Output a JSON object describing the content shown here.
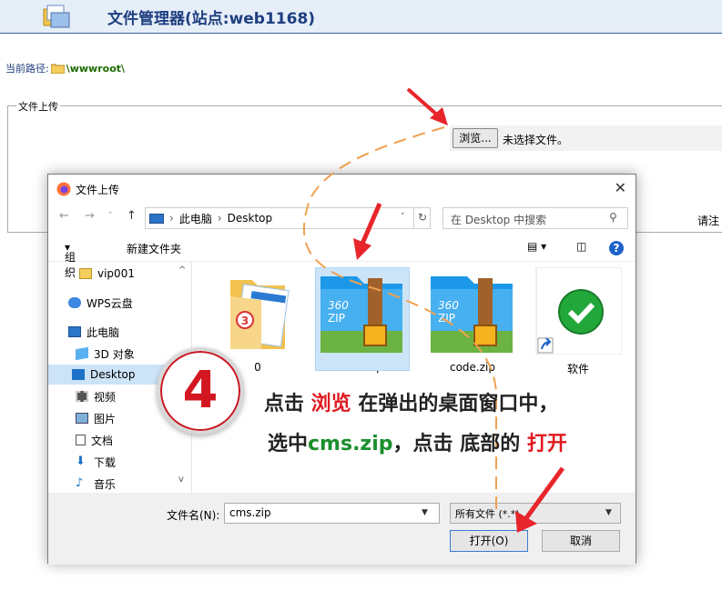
{
  "page": {
    "title": "文件管理器(站点:web1168)",
    "path_label": "当前路径:",
    "path_value": "\\wwwroot\\",
    "upload_legend": "文件上传",
    "browse_label": "浏览...",
    "no_file": "未选择文件。",
    "fill_hint": "请注"
  },
  "dialog": {
    "title": "文件上传",
    "close": "✕",
    "address": [
      "此电脑",
      "Desktop"
    ],
    "search_placeholder": "在 Desktop 中搜索",
    "toolbar": {
      "organize": "组织",
      "new_folder": "新建文件夹"
    },
    "sidebar": [
      {
        "label": "vip001",
        "icon": "folder-icon"
      },
      {
        "label": "WPS云盘",
        "icon": "cloud-icon"
      },
      {
        "label": "此电脑",
        "icon": "computer-icon"
      },
      {
        "label": "3D 对象",
        "icon": "3d-objects-icon"
      },
      {
        "label": "Desktop",
        "icon": "desktop-icon",
        "selected": true
      },
      {
        "label": "视频",
        "icon": "video-icon"
      },
      {
        "label": "图片",
        "icon": "picture-icon"
      },
      {
        "label": "文档",
        "icon": "document-icon"
      },
      {
        "label": "下载",
        "icon": "download-icon"
      },
      {
        "label": "音乐",
        "icon": "music-icon"
      }
    ],
    "files": [
      {
        "name": "0",
        "icon": "folder-icon"
      },
      {
        "name": "cms.zip",
        "icon": "zip-icon",
        "selected": true
      },
      {
        "name": "code.zip",
        "icon": "zip-icon"
      },
      {
        "name": "软件",
        "icon": "shortcut-icon"
      }
    ],
    "zip_brand": "360",
    "zip_text": "ZIP",
    "folder_badge": "3",
    "filename_label": "文件名(N):",
    "filename_value": "cms.zip",
    "filetype_value": "所有文件 (*.*)",
    "open_label": "打开(O)",
    "cancel_label": "取消"
  },
  "annotation": {
    "step": "4",
    "line1": [
      {
        "t": "点击 ",
        "c": ""
      },
      {
        "t": "浏览",
        "c": "red"
      },
      {
        "t": " 在弹出的桌面窗口中，",
        "c": ""
      }
    ],
    "line2": [
      {
        "t": "选中",
        "c": ""
      },
      {
        "t": "cms.zip",
        "c": "green"
      },
      {
        "t": "，点击 底部的 ",
        "c": ""
      },
      {
        "t": "打开",
        "c": "red"
      }
    ],
    "colors": {
      "red": "#e0191f",
      "green": "#1c8f2d",
      "arrow": "#e8252b",
      "dash": "#f0a050"
    }
  }
}
